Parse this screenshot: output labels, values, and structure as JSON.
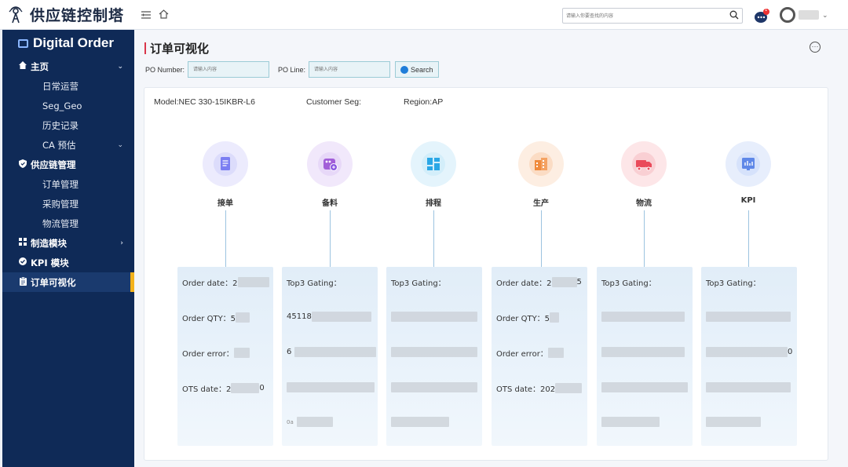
{
  "header": {
    "app_title": "供应链控制塔",
    "search_placeholder": "请输入你要查找的内容",
    "notification_count": "1"
  },
  "sidebar": {
    "title": "Digital Order",
    "groups": [
      {
        "label": "主页",
        "icon": "home-icon",
        "items": [
          "日常运营",
          "Seg_Geo",
          "历史记录",
          "CA 预估"
        ]
      },
      {
        "label": "供应链管理",
        "icon": "shield-icon",
        "items": [
          "订单管理",
          "采购管理",
          "物流管理"
        ]
      },
      {
        "label": "制造模块",
        "icon": "grid-icon"
      },
      {
        "label": "KPI 模块",
        "icon": "check-circle-icon"
      },
      {
        "label": "订单可视化",
        "icon": "clipboard-icon"
      }
    ]
  },
  "page": {
    "title": "订单可视化",
    "po_number_label": "PO Number:",
    "po_number_placeholder": "请输入内容",
    "po_line_label": "PO Line:",
    "po_line_placeholder": "请输入内容",
    "search_button": "Search"
  },
  "order_meta": {
    "model": "Model:NEC 330-15IKBR-L6",
    "customer_seg": "Customer Seg:",
    "region": "Region:AP"
  },
  "stages": [
    {
      "label": "接单",
      "icon": "document-icon",
      "color": "#7b7ef2"
    },
    {
      "label": "备料",
      "icon": "materials-icon",
      "color": "#a25fd8"
    },
    {
      "label": "排程",
      "icon": "layout-icon",
      "color": "#2aa7e6"
    },
    {
      "label": "生产",
      "icon": "factory-icon",
      "color": "#f08a3c"
    },
    {
      "label": "物流",
      "icon": "truck-icon",
      "color": "#ea4a5a"
    },
    {
      "label": "KPI",
      "icon": "chart-icon",
      "color": "#5f88e8"
    }
  ],
  "cards": [
    {
      "rows": [
        "Order date：2",
        "Order QTY：5",
        "Order error：",
        "OTS date：2"
      ],
      "row_suffix": [
        "",
        "",
        "",
        "0"
      ]
    },
    {
      "rows": [
        "Top3 Gating：",
        "45118",
        "6",
        "",
        "0a"
      ]
    },
    {
      "rows": [
        "Top3 Gating：",
        "",
        "",
        "",
        ""
      ]
    },
    {
      "rows": [
        "Order date：2",
        "Order QTY：5",
        "Order error：",
        "OTS date：202"
      ],
      "row_suffix": [
        "5",
        "",
        "",
        ""
      ]
    },
    {
      "rows": [
        "Top3 Gating：",
        "",
        "",
        "",
        ""
      ]
    },
    {
      "rows": [
        "Top3 Gating：",
        "",
        "",
        ""
      ],
      "row_suffix": [
        "",
        "",
        "0",
        ""
      ]
    }
  ]
}
